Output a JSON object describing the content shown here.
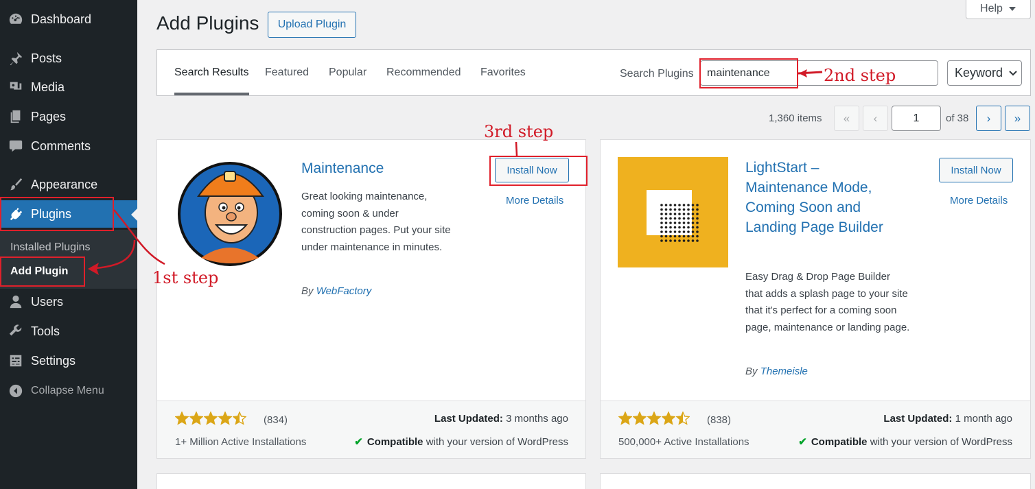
{
  "sidebar": {
    "items": [
      {
        "label": "Dashboard",
        "icon": "dashboard-icon"
      },
      {
        "label": "Posts",
        "icon": "pushpin-icon"
      },
      {
        "label": "Media",
        "icon": "media-icon"
      },
      {
        "label": "Pages",
        "icon": "pages-icon"
      },
      {
        "label": "Comments",
        "icon": "comment-icon"
      },
      {
        "label": "Appearance",
        "icon": "paintbrush-icon"
      },
      {
        "label": "Plugins",
        "icon": "plug-icon"
      },
      {
        "label": "Users",
        "icon": "users-icon"
      },
      {
        "label": "Tools",
        "icon": "wrench-icon"
      },
      {
        "label": "Settings",
        "icon": "settings-icon"
      }
    ],
    "submenu": {
      "installed": "Installed Plugins",
      "add": "Add Plugin"
    },
    "collapse": "Collapse Menu"
  },
  "header": {
    "title": "Add Plugins",
    "upload": "Upload Plugin",
    "help": "Help"
  },
  "filter": {
    "tabs": [
      "Search Results",
      "Featured",
      "Popular",
      "Recommended",
      "Favorites"
    ],
    "search_label": "Search Plugins",
    "search_value": "maintenance",
    "type": "Keyword"
  },
  "pagination": {
    "items": "1,360 items",
    "first": "«",
    "prev": "‹",
    "current": "1",
    "of": "of 38",
    "next": "›",
    "last": "»"
  },
  "plugins": [
    {
      "name": "Maintenance",
      "description": "Great looking maintenance, coming soon & under construction pages. Put your site under maintenance in minutes.",
      "by": "By",
      "author": "WebFactory",
      "install": "Install Now",
      "details": "More Details",
      "rating": 4.5,
      "rating_count": "(834)",
      "installs": "1+ Million Active Installations",
      "updated_label": "Last Updated:",
      "updated": "3 months ago",
      "compat_label": "Compatible",
      "compat_rest": "with your version of WordPress"
    },
    {
      "name": "LightStart – Maintenance Mode, Coming Soon and Landing Page Builder",
      "description": "Easy Drag & Drop Page Builder that adds a splash page to your site that it's perfect for a coming soon page, maintenance or landing page.",
      "by": "By",
      "author": "Themeisle",
      "install": "Install Now",
      "details": "More Details",
      "rating": 4.5,
      "rating_count": "(838)",
      "installs": "500,000+ Active Installations",
      "updated_label": "Last Updated:",
      "updated": "1 month ago",
      "compat_label": "Compatible",
      "compat_rest": "with your version of WordPress"
    }
  ],
  "annotations": {
    "step1": "1st step",
    "step2": "2nd step",
    "step3": "3rd step"
  },
  "colors": {
    "sidebar_bg": "#1d2327",
    "accent": "#2271b1",
    "star": "#dba617",
    "annotation": "#e0202b",
    "lightstart_bg": "#efb11f"
  }
}
